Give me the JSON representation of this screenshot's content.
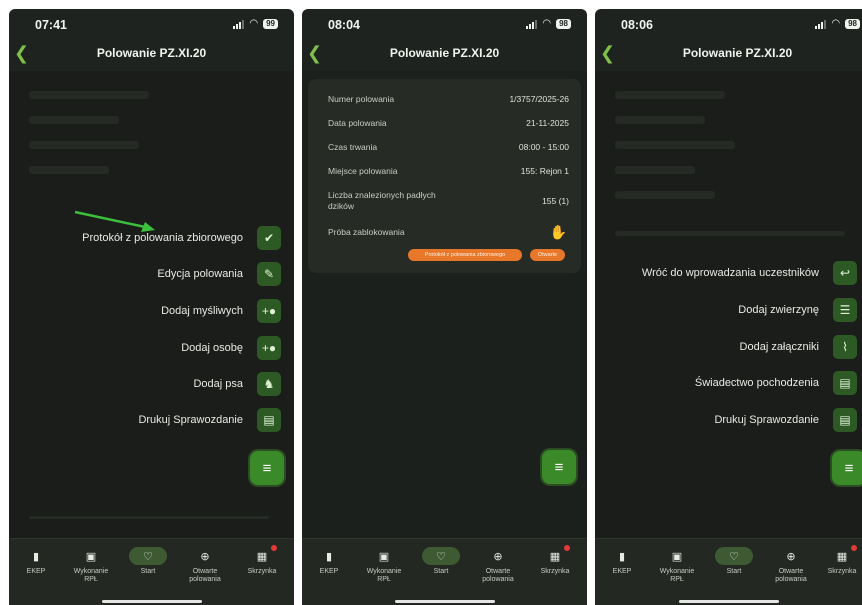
{
  "panels": [
    {
      "status": {
        "time": "07:41",
        "battery": "99"
      },
      "title": "Polowanie PZ.XI.20",
      "menu": [
        {
          "label": "Protokół z polowania zbiorowego",
          "icon": "document-check-icon",
          "glyph": "✔"
        },
        {
          "label": "Edycja polowania",
          "icon": "pencil-icon",
          "glyph": "✎"
        },
        {
          "label": "Dodaj myśliwych",
          "icon": "add-person-icon",
          "glyph": "+●"
        },
        {
          "label": "Dodaj osobę",
          "icon": "add-person-icon",
          "glyph": "+●"
        },
        {
          "label": "Dodaj psa",
          "icon": "dog-icon",
          "glyph": "♞"
        },
        {
          "label": "Drukuj Sprawozdanie",
          "icon": "document-icon",
          "glyph": "▤"
        }
      ]
    },
    {
      "status": {
        "time": "08:04",
        "battery": "98"
      },
      "title": "Polowanie PZ.XI.20",
      "details": [
        {
          "key": "Numer polowania",
          "value": "1/3757/2025-26"
        },
        {
          "key": "Data polowania",
          "value": "21-11-2025"
        },
        {
          "key": "Czas trwania",
          "value": "08:00 - 15:00"
        },
        {
          "key": "Miejsce polowania",
          "value": "155: Rejon 1"
        },
        {
          "key": "Liczba znalezionych padłych dzików",
          "value": "155 (1)"
        },
        {
          "key": "Próba zablokowania",
          "value": ""
        }
      ],
      "buttons": {
        "protocol": "Protokół z polowania zbiorowego",
        "open": "Otwarte"
      }
    },
    {
      "status": {
        "time": "08:06",
        "battery": "98"
      },
      "title": "Polowanie PZ.XI.20",
      "menu": [
        {
          "label": "Wróć do wprowadzania uczestników",
          "icon": "return-icon",
          "glyph": "↩"
        },
        {
          "label": "Dodaj zwierzynę",
          "icon": "list-add-icon",
          "glyph": "☰"
        },
        {
          "label": "Dodaj załączniki",
          "icon": "paperclip-icon",
          "glyph": "⌇"
        },
        {
          "label": "Świadectwo pochodzenia",
          "icon": "document-icon",
          "glyph": "▤"
        },
        {
          "label": "Drukuj Sprawozdanie",
          "icon": "document-icon",
          "glyph": "▤"
        }
      ]
    }
  ],
  "nav": [
    {
      "label": "EKEP",
      "icon": "book-icon",
      "glyph": "▮"
    },
    {
      "label": "Wykonanie RPŁ",
      "icon": "calendar-icon",
      "glyph": "▣"
    },
    {
      "label": "Start",
      "icon": "home-icon",
      "glyph": "♡"
    },
    {
      "label": "Otwarte polowania",
      "icon": "crosshair-icon",
      "glyph": "⊕"
    },
    {
      "label": "Skrzynka",
      "icon": "inbox-icon",
      "glyph": "▦"
    }
  ],
  "colors": {
    "accent": "#3b8a2a",
    "background": "#1f231f",
    "orange": "#e8772a",
    "alert": "#e04a2a"
  }
}
